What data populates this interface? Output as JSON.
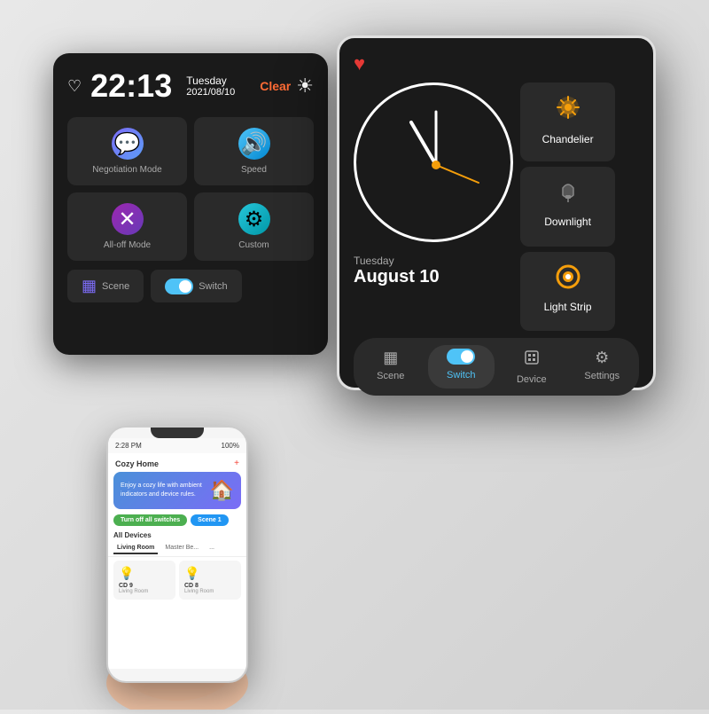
{
  "back_device": {
    "heart": "♡",
    "time": "22:13",
    "weekday": "Tuesday",
    "date": "2021/08/10",
    "weather_label": "Clear",
    "weather_icon": "☀",
    "cards": [
      {
        "icon": "💬",
        "label": "Negotiation Mode",
        "color": "#7c6cf6"
      },
      {
        "icon": "🔊",
        "label": "Speed",
        "color": "#4fc3f7"
      },
      {
        "icon": "✕",
        "label": "All-off Mode",
        "color": "#9c27b0"
      },
      {
        "icon": "⚙",
        "label": "Custom",
        "color": "#4fc3f7"
      }
    ],
    "bottom": [
      {
        "icon": "▦",
        "label": "Scene"
      },
      {
        "icon": "toggle",
        "label": "Switch"
      }
    ]
  },
  "front_device": {
    "heart": "♥",
    "clock": {
      "weekday": "Tuesday",
      "day": "August 10"
    },
    "device_buttons": [
      {
        "id": "chandelier",
        "icon": "🔔",
        "label": "Chandelier",
        "icon_color": "#f59e0b"
      },
      {
        "id": "downlight",
        "icon": "🔔",
        "label": "Downlight",
        "icon_color": "#888"
      },
      {
        "id": "lightstrip",
        "icon": "◎",
        "label": "Light Strip",
        "icon_color": "#f59e0b"
      }
    ],
    "tabs": [
      {
        "id": "scene",
        "icon": "▦",
        "label": "Scene",
        "active": false
      },
      {
        "id": "switch",
        "icon": "toggle",
        "label": "Switch",
        "active": true
      },
      {
        "id": "device",
        "icon": "📱",
        "label": "Device",
        "active": false
      },
      {
        "id": "settings",
        "icon": "⚙",
        "label": "Settings",
        "active": false
      }
    ]
  },
  "phone": {
    "status_left": "2:28 PM",
    "status_right": "100%",
    "app_title": "Cozy Home",
    "hero_text": "Enjoy a cozy life with ambient indicators and device rules.",
    "hero_icon": "🏠",
    "actions": [
      "Turn off all switches",
      "Scene 1"
    ],
    "section_title": "All Devices",
    "tabs": [
      "Living Room",
      "Master Be...",
      "..."
    ],
    "devices": [
      {
        "icon": "💡",
        "name": "CD 9",
        "room": "Living Room"
      },
      {
        "icon": "💡",
        "name": "CD 8",
        "room": "Living Room"
      }
    ]
  }
}
